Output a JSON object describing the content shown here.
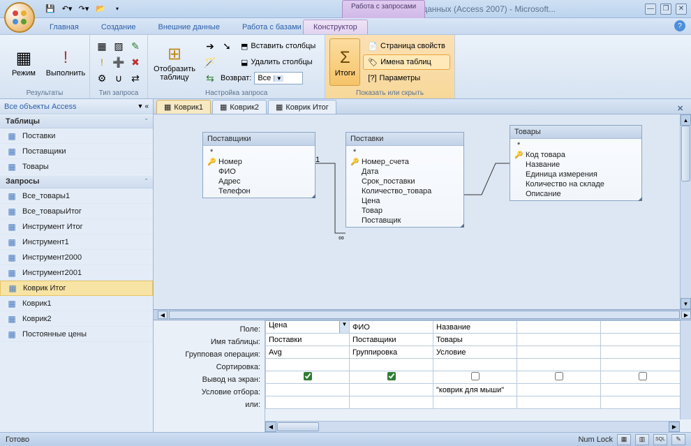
{
  "window": {
    "title": "вар 3 : база данных (Access 2007) - Microsoft...",
    "context_title": "Работа с запросами"
  },
  "tabs": {
    "home": "Главная",
    "create": "Создание",
    "external": "Внешние данные",
    "dbtools": "Работа с базами данных",
    "design": "Конструктор"
  },
  "ribbon": {
    "results": {
      "mode": "Режим",
      "run": "Выполнить",
      "group": "Результаты"
    },
    "querytype": {
      "group": "Тип запроса"
    },
    "setup": {
      "showtable": "Отобразить таблицу",
      "insert_cols": "Вставить столбцы",
      "delete_cols": "Удалить столбцы",
      "return_label": "Возврат:",
      "return_value": "Все",
      "group": "Настройка запроса"
    },
    "totals": {
      "btn": "Итоги"
    },
    "showhide": {
      "prop_sheet": "Страница свойств",
      "table_names": "Имена таблиц",
      "params": "Параметры",
      "group": "Показать или скрыть"
    }
  },
  "nav": {
    "header": "Все объекты Access",
    "groups": {
      "tables": "Таблицы",
      "queries": "Запросы"
    },
    "tables": [
      "Поставки",
      "Поставщики",
      "Товары"
    ],
    "queries": [
      "Все_товары1",
      "Все_товарыИтог",
      "Инструмент Итог",
      "Инструмент1",
      "Инструмент2000",
      "Инструмент2001",
      "Коврик Итог",
      "Коврик1",
      "Коврик2",
      "Постоянные цены"
    ],
    "selected_query": "Коврик Итог"
  },
  "doctabs": {
    "tab1": "Коврик1",
    "tab2": "Коврик2",
    "tab3": "Коврик Итог"
  },
  "tables_diagram": {
    "suppliers": {
      "title": "Поставщики",
      "fields": [
        "*",
        "Номер",
        "ФИО",
        "Адрес",
        "Телефон"
      ],
      "key_idx": 1
    },
    "deliveries": {
      "title": "Поставки",
      "fields": [
        "*",
        "Номер_счета",
        "Дата",
        "Срок_поставки",
        "Количество_товара",
        "Цена",
        "Товар",
        "Поставщик"
      ],
      "key_idx": 1
    },
    "goods": {
      "title": "Товары",
      "fields": [
        "*",
        "Код товара",
        "Название",
        "Единица измерения",
        "Количество на складе",
        "Описание"
      ],
      "key_idx": 1
    }
  },
  "grid": {
    "labels": {
      "field": "Поле:",
      "table": "Имя таблицы:",
      "groupop": "Групповая операция:",
      "sort": "Сортировка:",
      "show": "Вывод на экран:",
      "criteria": "Условие отбора:",
      "or": "или:"
    },
    "cols": [
      {
        "field": "Цена",
        "table": "Поставки",
        "group": "Avg",
        "show": true,
        "criteria": ""
      },
      {
        "field": "ФИО",
        "table": "Поставщики",
        "group": "Группировка",
        "show": true,
        "criteria": ""
      },
      {
        "field": "Название",
        "table": "Товары",
        "group": "Условие",
        "show": false,
        "criteria": "\"коврик для мыши\""
      },
      {
        "field": "",
        "table": "",
        "group": "",
        "show": false,
        "criteria": ""
      },
      {
        "field": "",
        "table": "",
        "group": "",
        "show": false,
        "criteria": ""
      }
    ]
  },
  "status": {
    "ready": "Готово",
    "numlock": "Num Lock"
  }
}
